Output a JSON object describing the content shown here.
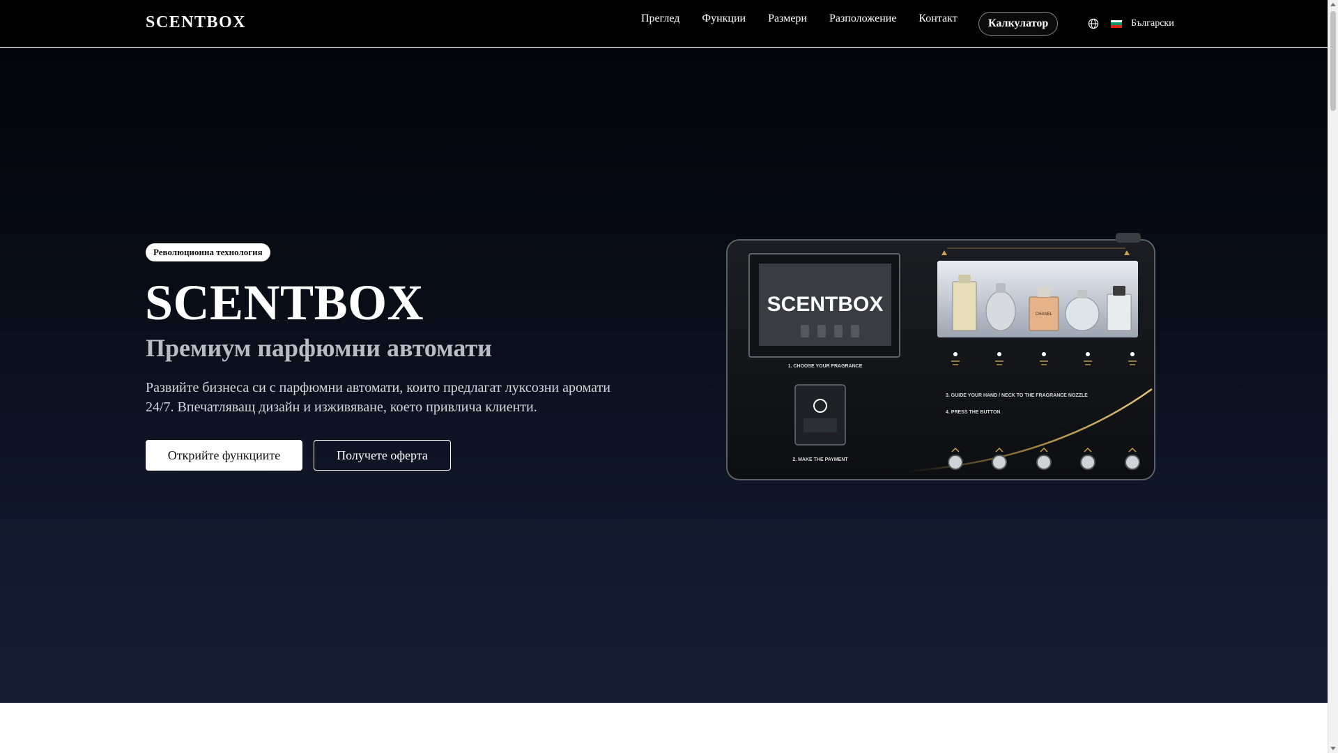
{
  "brand": {
    "logo": "SCENTBOX"
  },
  "nav": {
    "items": [
      {
        "label": "Преглед"
      },
      {
        "label": "Функции"
      },
      {
        "label": "Размери"
      },
      {
        "label": "Разположение"
      },
      {
        "label": "Контакт"
      }
    ],
    "calculator_label": "Калкулатор",
    "language_icon": "globe-icon",
    "language_label": "Български",
    "flag_colors": [
      "#ffffff",
      "#00966e",
      "#d62612"
    ]
  },
  "hero": {
    "badge": "Революционна технология",
    "title": "SCENTBOX",
    "subtitle": "Премиум парфюмни автомати",
    "description": "Развийте бизнеса си с парфюмни автомати, които предлагат луксозни аромати 24/7. Впечатляващ дизайн и изживяване, което привлича клиенти.",
    "primary_button": "Открийте функциите",
    "secondary_button": "Получете оферта"
  },
  "machine": {
    "screen_logo": "SCENTBOX",
    "step1": "1. CHOOSE YOUR FRAGRANCE",
    "step2": "2. MAKE THE PAYMENT",
    "step3": "3. GUIDE YOUR HAND / NECK TO THE FRAGRANCE NOZZLE",
    "step4": "4. PRESS THE BUTTON",
    "bottle_label": "CHANEL",
    "accent_color": "#c9a24a"
  },
  "colors": {
    "header_bg": "#000000",
    "hero_bg_top": "#03050a",
    "hero_bg_bottom": "#151d33",
    "text_primary": "#ffffff",
    "text_muted": "#b9bcc4"
  }
}
